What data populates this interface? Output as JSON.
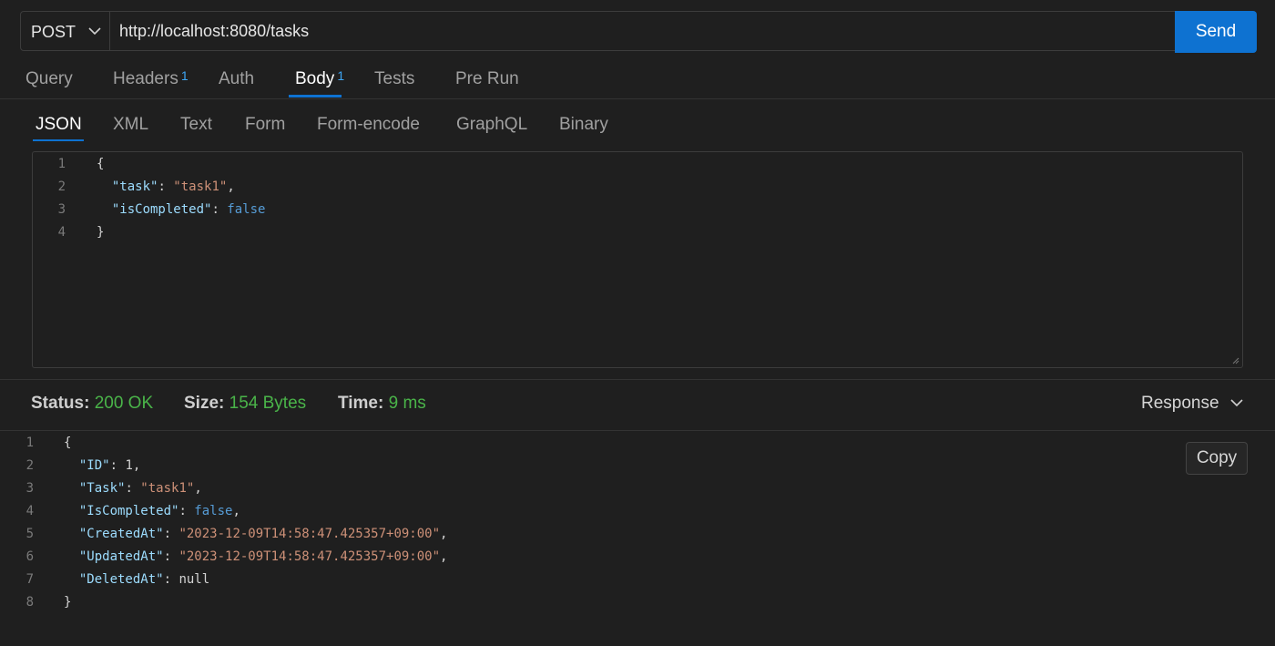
{
  "request": {
    "method": "POST",
    "url": "http://localhost:8080/tasks",
    "send_label": "Send"
  },
  "main_tabs": [
    {
      "label": "Query",
      "badge": ""
    },
    {
      "label": "Headers",
      "badge": "1"
    },
    {
      "label": "Auth",
      "badge": ""
    },
    {
      "label": "Body",
      "badge": "1"
    },
    {
      "label": "Tests",
      "badge": ""
    },
    {
      "label": "Pre Run",
      "badge": ""
    }
  ],
  "body_tabs": [
    "JSON",
    "XML",
    "Text",
    "Form",
    "Form-encode",
    "GraphQL",
    "Binary"
  ],
  "request_body": {
    "line_numbers": [
      "1",
      "2",
      "3",
      "4"
    ],
    "tokens": {
      "open": "{",
      "task_key": "\"task\"",
      "colon1": ": ",
      "task_val": "\"task1\"",
      "comma1": ",",
      "iscompleted_key": "\"isCompleted\"",
      "colon2": ": ",
      "iscompleted_val": "false",
      "close": "}"
    }
  },
  "status": {
    "status_label": "Status:",
    "status_value": "200 OK",
    "size_label": "Size:",
    "size_value": "154 Bytes",
    "time_label": "Time:",
    "time_value": "9 ms",
    "response_select": "Response"
  },
  "response_body": {
    "line_numbers": [
      "1",
      "2",
      "3",
      "4",
      "5",
      "6",
      "7",
      "8"
    ],
    "copy_label": "Copy",
    "tokens": {
      "open": "{",
      "id_key": "\"ID\"",
      "id_val": "1",
      "task_key": "\"Task\"",
      "task_val": "\"task1\"",
      "iscompleted_key": "\"IsCompleted\"",
      "iscompleted_val": "false",
      "created_key": "\"CreatedAt\"",
      "created_val": "\"2023-12-09T14:58:47.425357+09:00\"",
      "updated_key": "\"UpdatedAt\"",
      "updated_val": "\"2023-12-09T14:58:47.425357+09:00\"",
      "deleted_key": "\"DeletedAt\"",
      "deleted_val": "null",
      "colon": ": ",
      "comma": ",",
      "close": "}"
    }
  },
  "colors": {
    "accent": "#0e72d1",
    "status_ok": "#4ab449",
    "json_key": "#9cdcfe",
    "json_string": "#ce9178",
    "json_keyword": "#569cd6"
  }
}
